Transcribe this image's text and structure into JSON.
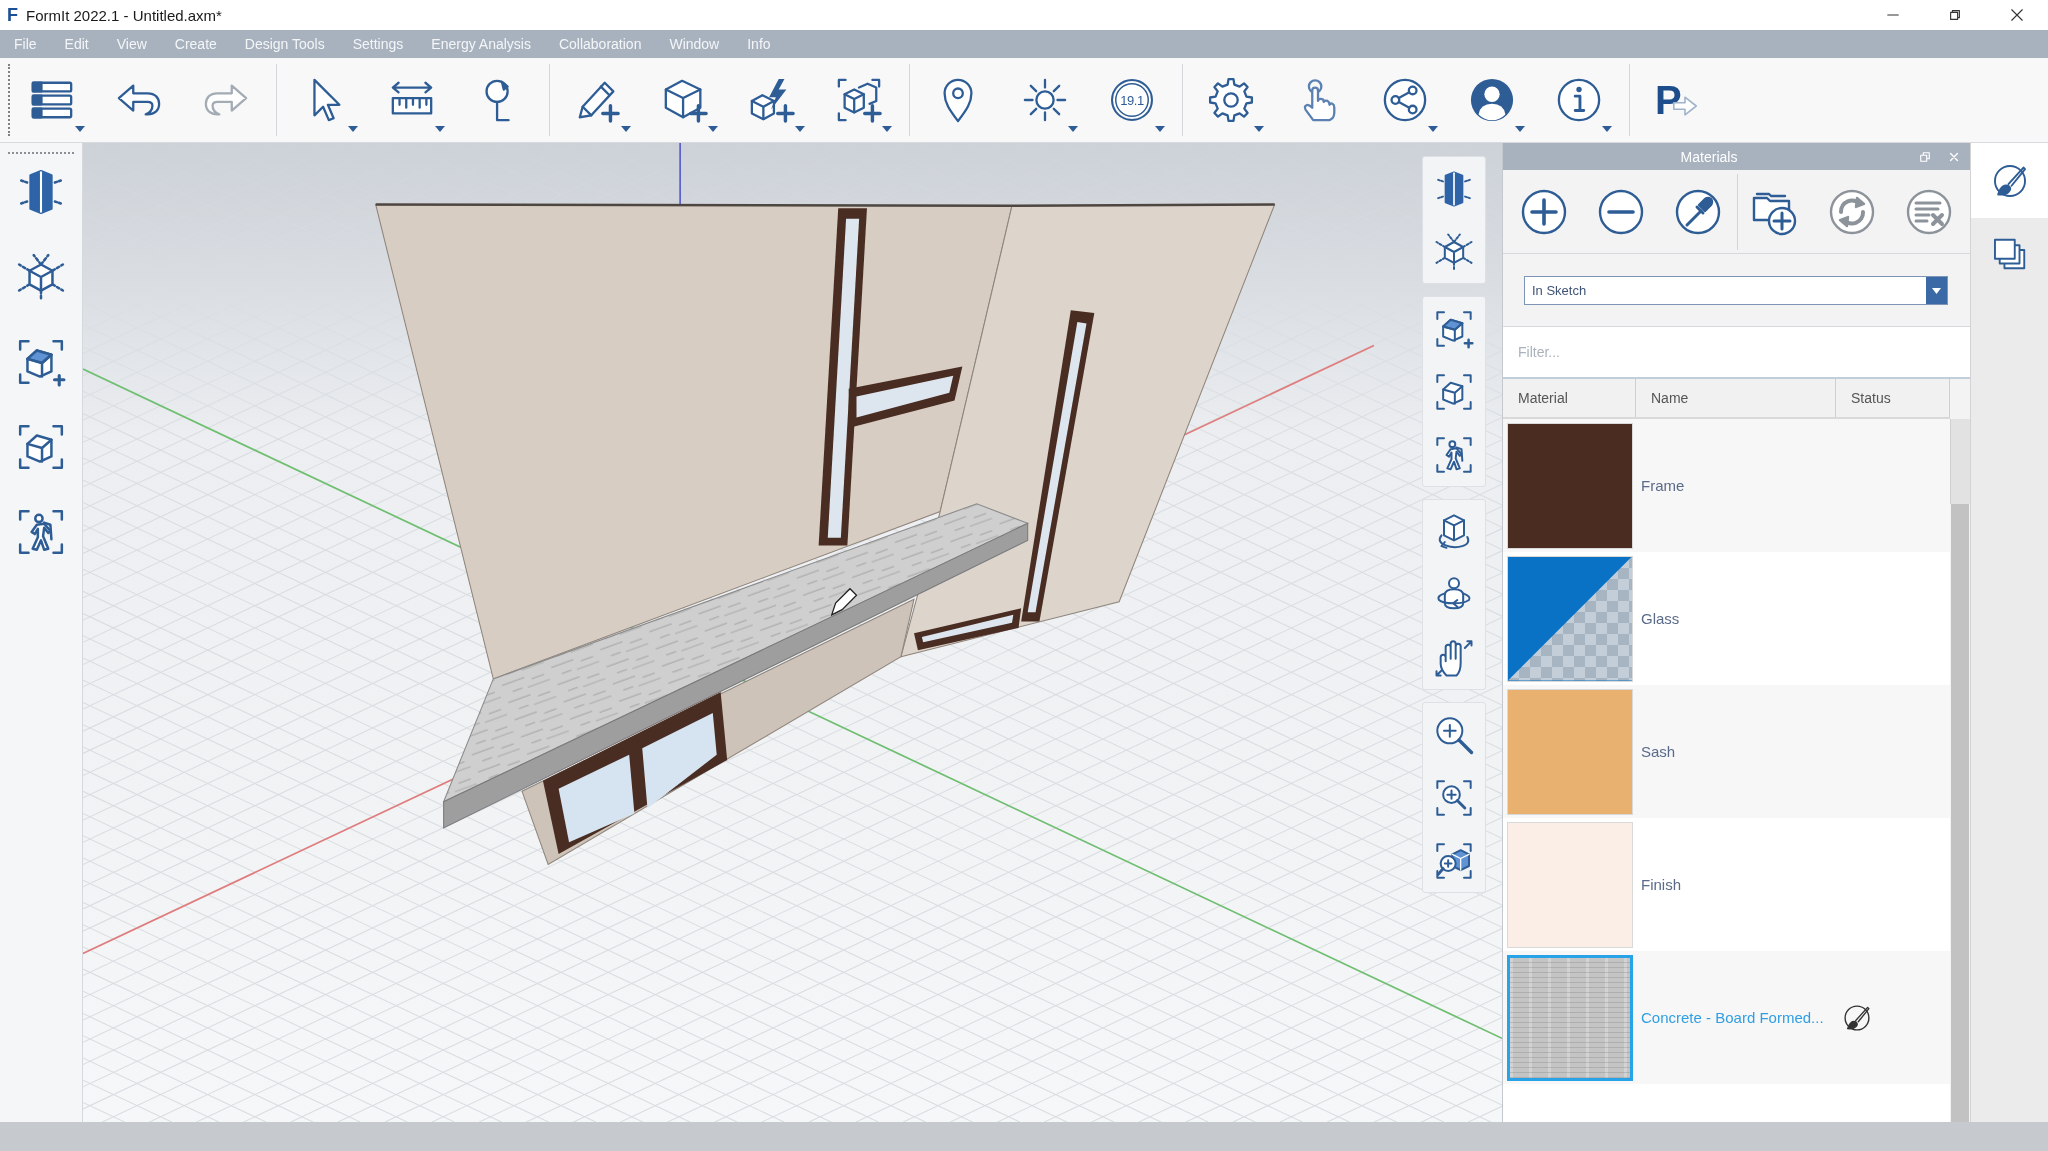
{
  "window": {
    "logo_letter": "F",
    "title": "FormIt 2022.1 - Untitled.axm*"
  },
  "menu": [
    "File",
    "Edit",
    "View",
    "Create",
    "Design Tools",
    "Settings",
    "Energy Analysis",
    "Collaboration",
    "Window",
    "Info"
  ],
  "toolbar": {
    "history_buttons": [
      {
        "kind": "undo",
        "disabled": false
      },
      {
        "kind": "redo",
        "disabled": true
      }
    ],
    "elevation_badge": "19.1",
    "logo_letter": "P"
  },
  "materials_panel": {
    "title": "Materials",
    "tool_groups": [
      [
        {
          "kind": "add",
          "disabled": false
        },
        {
          "kind": "remove",
          "disabled": false
        },
        {
          "kind": "pick",
          "disabled": false
        }
      ],
      [
        {
          "kind": "import",
          "disabled": false
        },
        {
          "kind": "refresh",
          "disabled": true
        },
        {
          "kind": "purge",
          "disabled": true
        }
      ]
    ],
    "source_dropdown": {
      "value": "In Sketch"
    },
    "filter": {
      "placeholder": "Filter..."
    },
    "table": {
      "columns": [
        "Material",
        "Name",
        "Status"
      ],
      "rows": [
        {
          "name": "Frame",
          "kind": "solid",
          "color": "#4b2c20",
          "selected": false,
          "paint_active": false
        },
        {
          "name": "Glass",
          "kind": "glass",
          "color": "#0a72c4",
          "selected": false,
          "paint_active": false
        },
        {
          "name": "Sash",
          "kind": "solid",
          "color": "#e8b170",
          "selected": false,
          "paint_active": false
        },
        {
          "name": "Finish",
          "kind": "solid",
          "color": "#fbeee6",
          "selected": false,
          "paint_active": false
        },
        {
          "name": "Concrete - Board Formed...",
          "kind": "texture",
          "color": "#c4c4c4",
          "selected": true,
          "paint_active": true
        }
      ]
    }
  },
  "side_tabs": [
    {
      "kind": "materials",
      "selected": true
    },
    {
      "kind": "layers",
      "selected": false
    }
  ]
}
